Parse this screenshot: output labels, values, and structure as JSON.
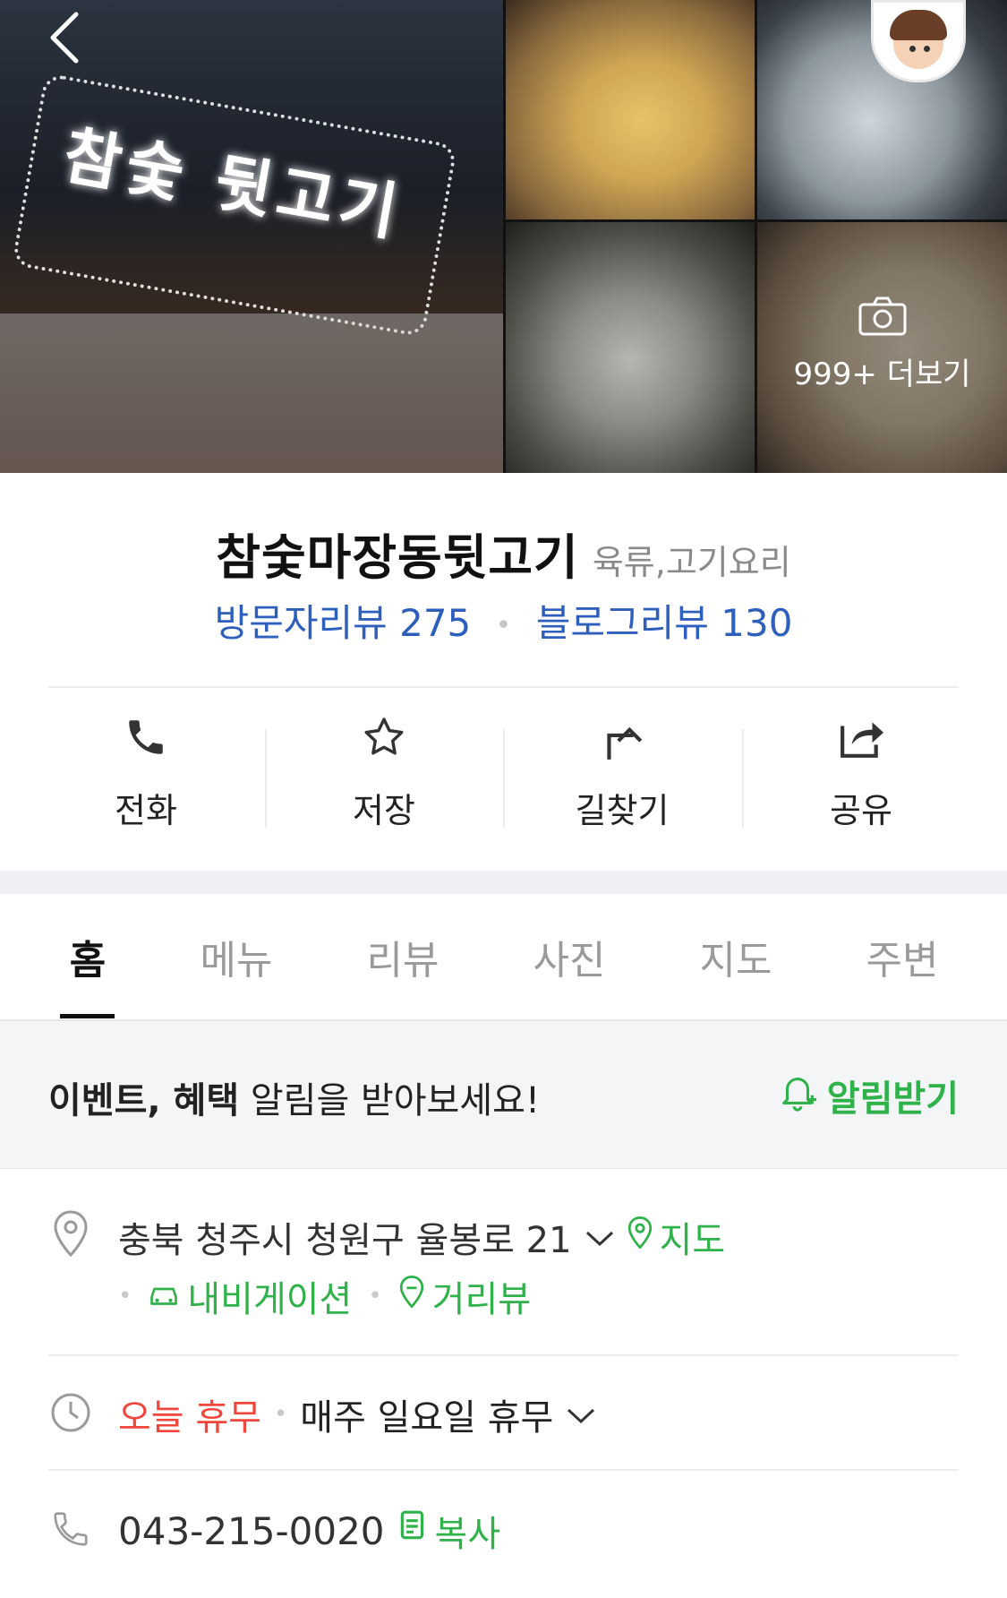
{
  "header": {
    "back_icon": "chevron-left-icon",
    "storefront_sign": "참숯 뒷고기",
    "more_photos_label": "999+ 더보기",
    "camera_icon": "camera-icon"
  },
  "place": {
    "name": "참숯마장동뒷고기",
    "category": "육류,고기요리",
    "visitor_reviews_label": "방문자리뷰 275",
    "blog_reviews_label": "블로그리뷰 130"
  },
  "actions": [
    {
      "label": "전화",
      "icon": "phone-icon"
    },
    {
      "label": "저장",
      "icon": "star-icon"
    },
    {
      "label": "길찾기",
      "icon": "directions-icon"
    },
    {
      "label": "공유",
      "icon": "share-icon"
    }
  ],
  "tabs": [
    {
      "label": "홈",
      "active": true
    },
    {
      "label": "메뉴",
      "active": false
    },
    {
      "label": "리뷰",
      "active": false
    },
    {
      "label": "사진",
      "active": false
    },
    {
      "label": "지도",
      "active": false
    },
    {
      "label": "주변",
      "active": false
    }
  ],
  "alert": {
    "bold_text": "이벤트, 혜택",
    "text": " 알림을 받아보세요!",
    "button_label": "알림받기"
  },
  "info": {
    "address": "충북 청주시 청원구 율봉로 21",
    "map_link": "지도",
    "navigation_link": "내비게이션",
    "streetview_link": "거리뷰",
    "today_status": "오늘 휴무",
    "hours_detail": "매주 일요일 휴무",
    "phone": "043-215-0020",
    "copy_label": "복사"
  },
  "colors": {
    "link_blue": "#2e5fbd",
    "green": "#2fb24a",
    "red": "#f0463b"
  }
}
